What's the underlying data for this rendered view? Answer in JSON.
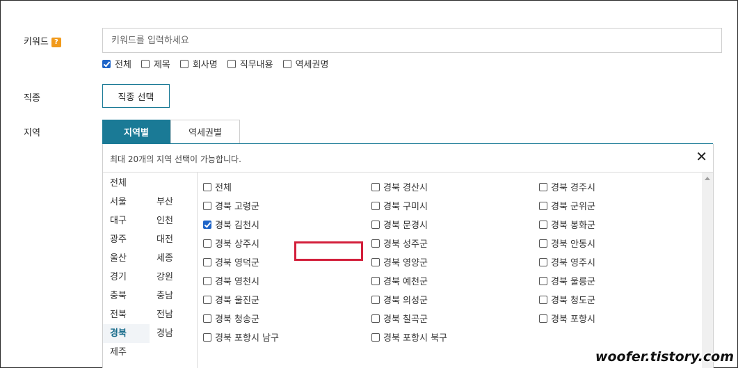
{
  "keyword": {
    "label": "키워드",
    "help_icon": "?",
    "placeholder": "키워드를 입력하세요",
    "value": "",
    "scopes": [
      {
        "label": "전체",
        "checked": true
      },
      {
        "label": "제목",
        "checked": false
      },
      {
        "label": "회사명",
        "checked": false
      },
      {
        "label": "직무내용",
        "checked": false
      },
      {
        "label": "역세권명",
        "checked": false
      }
    ]
  },
  "job": {
    "label": "직종",
    "button": "직종 선택"
  },
  "region": {
    "label": "지역",
    "tabs": [
      {
        "label": "지역별",
        "active": true
      },
      {
        "label": "역세권별",
        "active": false
      }
    ],
    "note": "최대 20개의 지역 선택이 가능합니다.",
    "close_icon": "close-icon",
    "areas": [
      {
        "label": "전체",
        "selected": false
      },
      {
        "label": "서울",
        "selected": false
      },
      {
        "label": "부산",
        "selected": false
      },
      {
        "label": "대구",
        "selected": false
      },
      {
        "label": "인천",
        "selected": false
      },
      {
        "label": "광주",
        "selected": false
      },
      {
        "label": "대전",
        "selected": false
      },
      {
        "label": "울산",
        "selected": false
      },
      {
        "label": "세종",
        "selected": false
      },
      {
        "label": "경기",
        "selected": false
      },
      {
        "label": "강원",
        "selected": false
      },
      {
        "label": "충북",
        "selected": false
      },
      {
        "label": "충남",
        "selected": false
      },
      {
        "label": "전북",
        "selected": false
      },
      {
        "label": "전남",
        "selected": false
      },
      {
        "label": "경북",
        "selected": true
      },
      {
        "label": "경남",
        "selected": false
      },
      {
        "label": "제주",
        "selected": false
      }
    ],
    "cities": [
      {
        "label": "전체",
        "checked": false
      },
      {
        "label": "경북 경산시",
        "checked": false
      },
      {
        "label": "경북 경주시",
        "checked": false
      },
      {
        "label": "경북 고령군",
        "checked": false
      },
      {
        "label": "경북 구미시",
        "checked": false
      },
      {
        "label": "경북 군위군",
        "checked": false
      },
      {
        "label": "경북 김천시",
        "checked": true
      },
      {
        "label": "경북 문경시",
        "checked": false
      },
      {
        "label": "경북 봉화군",
        "checked": false
      },
      {
        "label": "경북 상주시",
        "checked": false
      },
      {
        "label": "경북 성주군",
        "checked": false
      },
      {
        "label": "경북 안동시",
        "checked": false
      },
      {
        "label": "경북 영덕군",
        "checked": false
      },
      {
        "label": "경북 영양군",
        "checked": false
      },
      {
        "label": "경북 영주시",
        "checked": false
      },
      {
        "label": "경북 영천시",
        "checked": false
      },
      {
        "label": "경북 예천군",
        "checked": false
      },
      {
        "label": "경북 울릉군",
        "checked": false
      },
      {
        "label": "경북 울진군",
        "checked": false
      },
      {
        "label": "경북 의성군",
        "checked": false
      },
      {
        "label": "경북 청도군",
        "checked": false
      },
      {
        "label": "경북 청송군",
        "checked": false
      },
      {
        "label": "경북 칠곡군",
        "checked": false
      },
      {
        "label": "경북 포항시",
        "checked": false
      },
      {
        "label": "경북 포항시 남구",
        "checked": false
      },
      {
        "label": "경북 포항시 북구",
        "checked": false
      }
    ]
  },
  "watermark": "woofer.tistory.com",
  "colors": {
    "accent": "#1a7a96",
    "highlight": "#d31f3b",
    "help": "#f19a1b",
    "checkbox": "#1e64c8"
  }
}
